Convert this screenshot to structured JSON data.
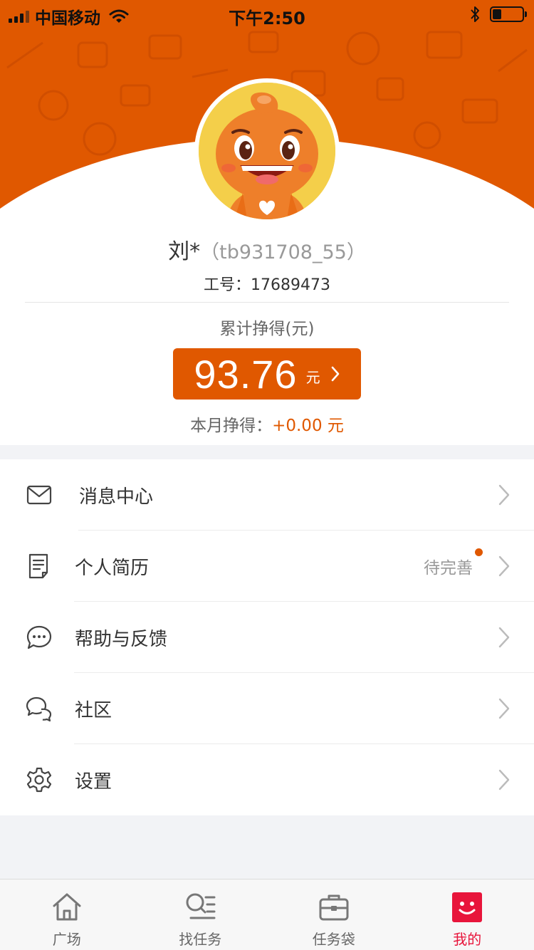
{
  "status_bar": {
    "carrier": "中国移动",
    "time": "下午2:50",
    "battery_level": 0.3
  },
  "profile": {
    "name": "刘*",
    "username": "（tb931708_55）",
    "employee_id_label": "工号：",
    "employee_id": "17689473",
    "earnings_title": "累计挣得(元)",
    "earnings_amount": "93.76",
    "earnings_unit": "元",
    "monthly_label": "本月挣得：",
    "monthly_value": "+0.00 元"
  },
  "menu": {
    "items": [
      {
        "label": "消息中心",
        "icon": "mail-icon"
      },
      {
        "label": "个人简历",
        "icon": "resume-icon",
        "status": "待完善"
      },
      {
        "label": "帮助与反馈",
        "icon": "chat-bubble-icon"
      },
      {
        "label": "社区",
        "icon": "community-icon"
      },
      {
        "label": "设置",
        "icon": "gear-icon"
      }
    ]
  },
  "tabbar": {
    "tabs": [
      {
        "label": "广场",
        "icon": "home-icon"
      },
      {
        "label": "找任务",
        "icon": "search-list-icon"
      },
      {
        "label": "任务袋",
        "icon": "briefcase-icon"
      },
      {
        "label": "我的",
        "icon": "smiley-icon",
        "active": true
      }
    ]
  },
  "colors": {
    "brand_orange": "#e05800",
    "active_tab_red": "#e8153b",
    "avatar_yellow": "#f4cf4a"
  }
}
